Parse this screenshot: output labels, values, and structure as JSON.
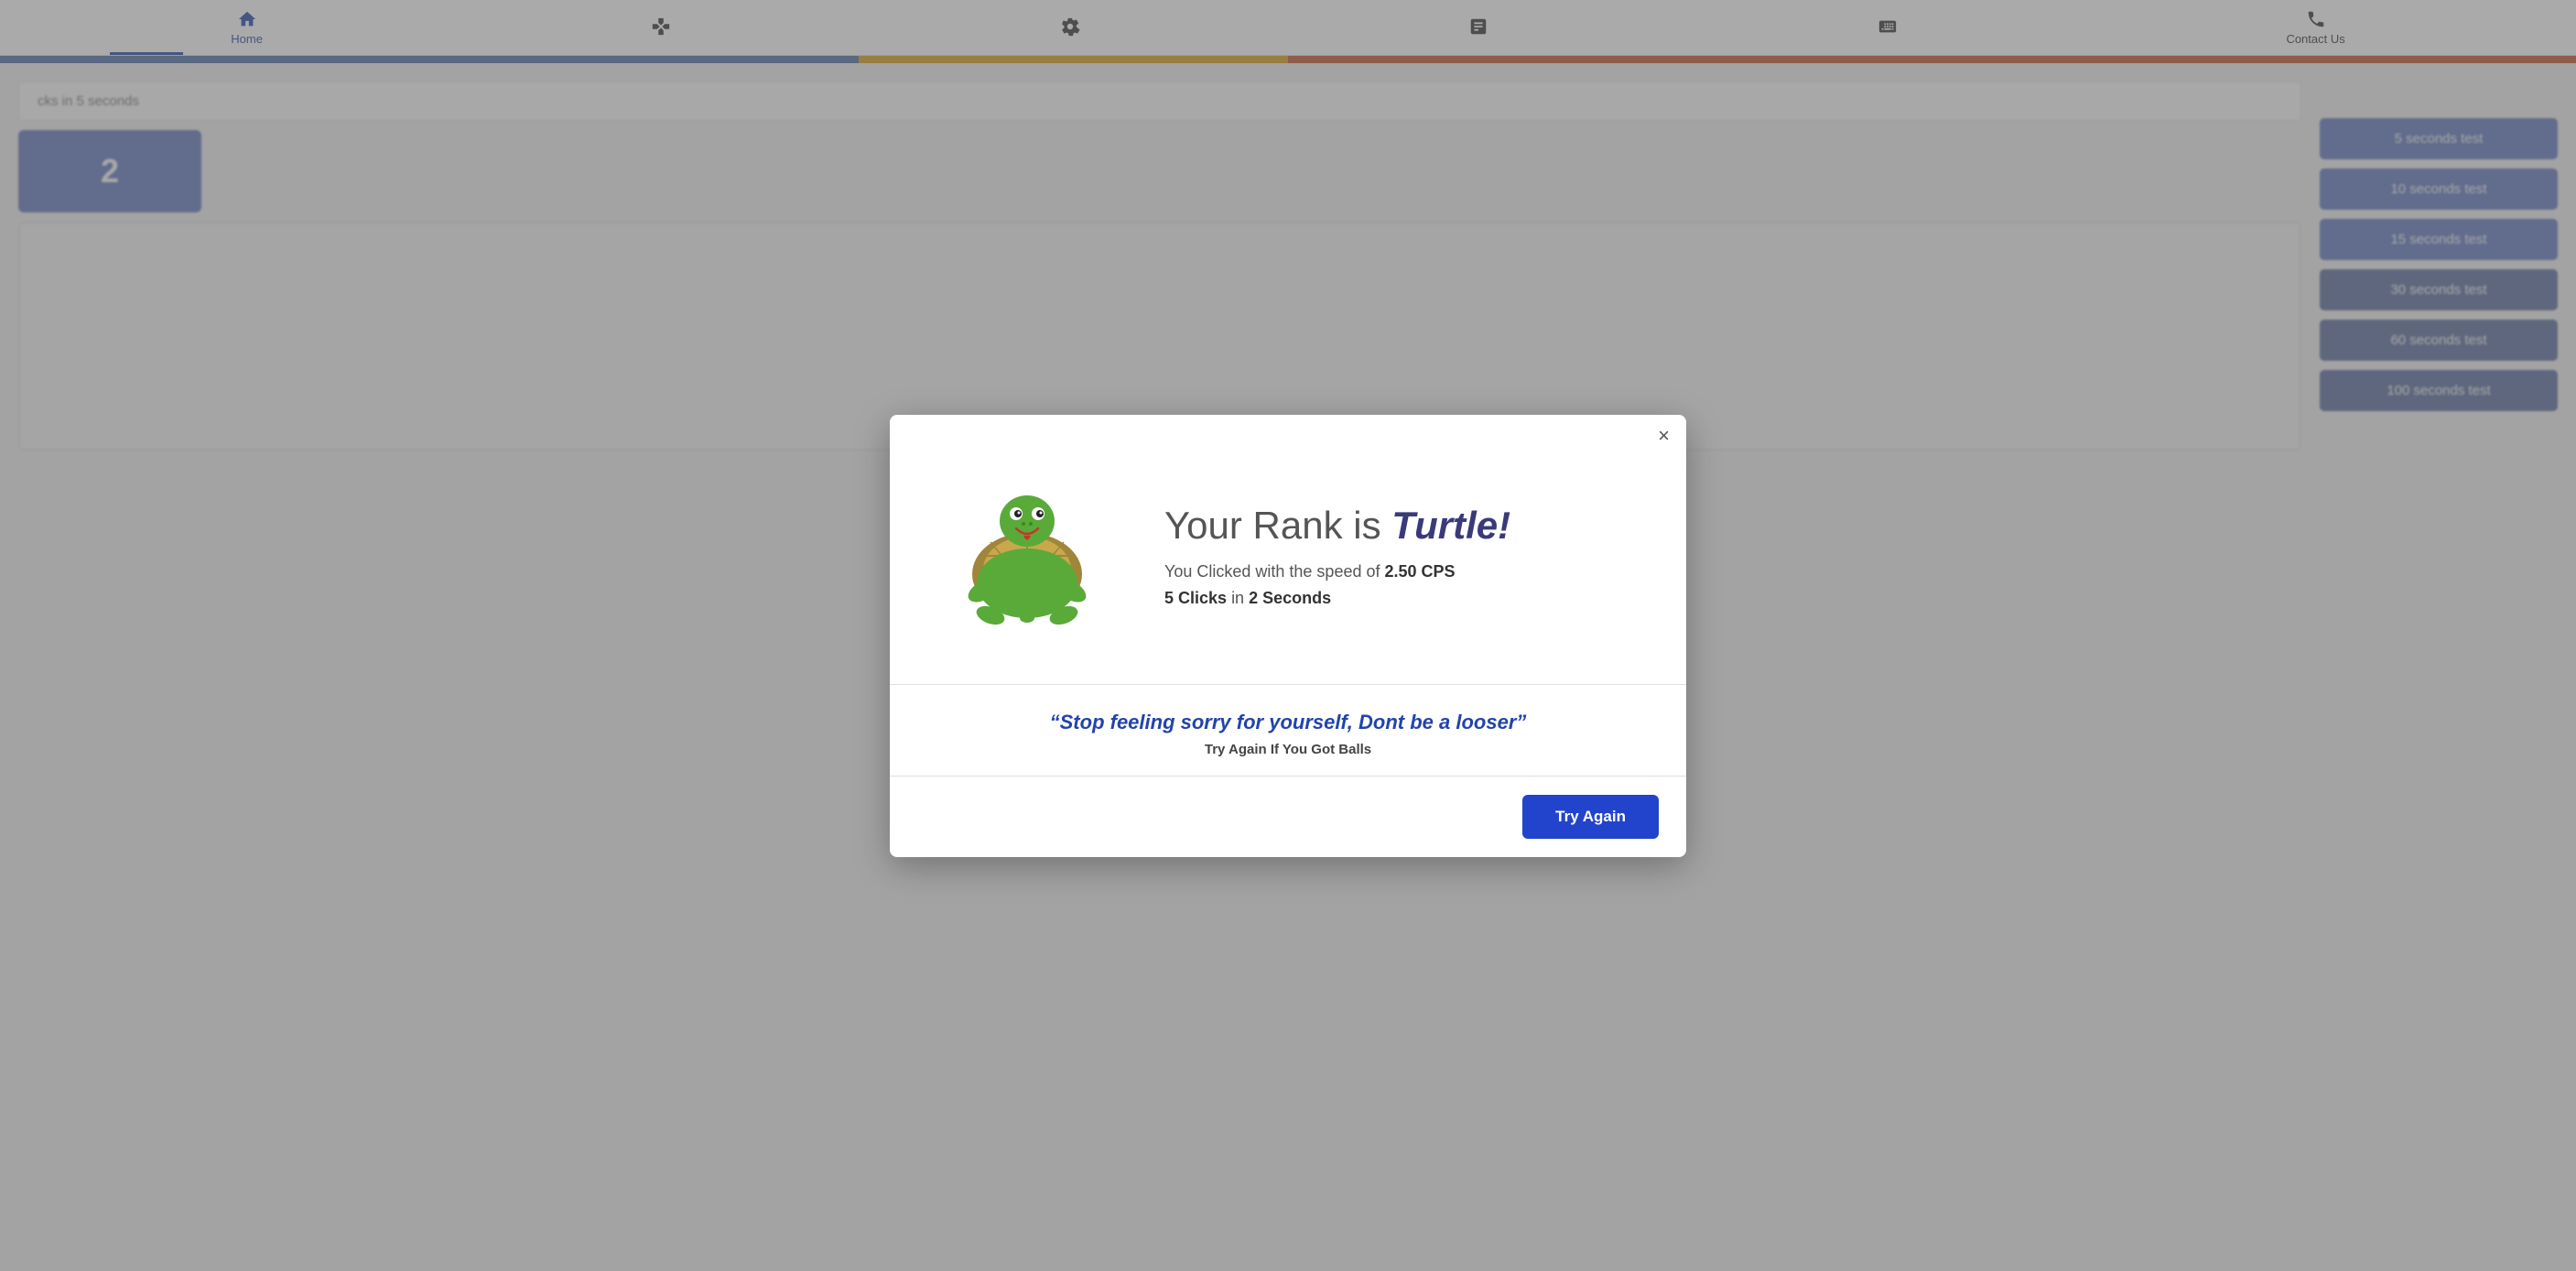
{
  "navbar": {
    "items": [
      {
        "label": "Home",
        "active": true
      },
      {
        "label": ""
      },
      {
        "label": ""
      },
      {
        "label": ""
      },
      {
        "label": ""
      },
      {
        "label": "Contact Us",
        "active": false
      }
    ]
  },
  "sidebar": {
    "buttons": [
      {
        "label": "5 seconds test"
      },
      {
        "label": "10 seconds test"
      },
      {
        "label": "15 seconds test"
      },
      {
        "label": "30 seconds test"
      },
      {
        "label": "60 seconds test"
      },
      {
        "label": "100 seconds test"
      }
    ]
  },
  "modal": {
    "close_label": "×",
    "rank_prefix": "Your Rank is",
    "rank_value": "Turtle!",
    "cps_text": "You Clicked with the speed of",
    "cps_value": "2.50 CPS",
    "clicks_count": "5 Clicks",
    "clicks_in": "in",
    "clicks_time": "2 Seconds",
    "quote": "“Stop feeling sorry for yourself, Dont be a looser”",
    "quote_sub": "Try Again If You Got Balls",
    "try_again": "Try Again"
  },
  "background": {
    "panel_title": "cks in 5 seconds",
    "click_number": "2"
  }
}
